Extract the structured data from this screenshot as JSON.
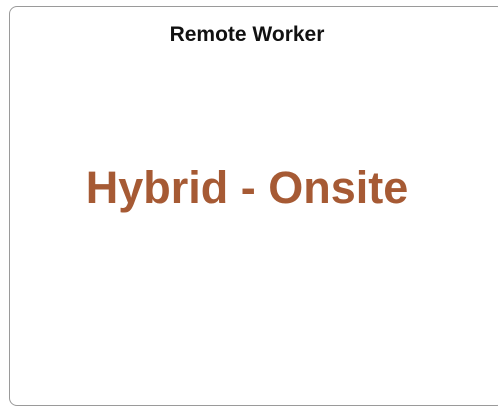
{
  "tile": {
    "title": "Remote Worker",
    "value": "Hybrid - Onsite",
    "value_color": "#a65a34"
  }
}
